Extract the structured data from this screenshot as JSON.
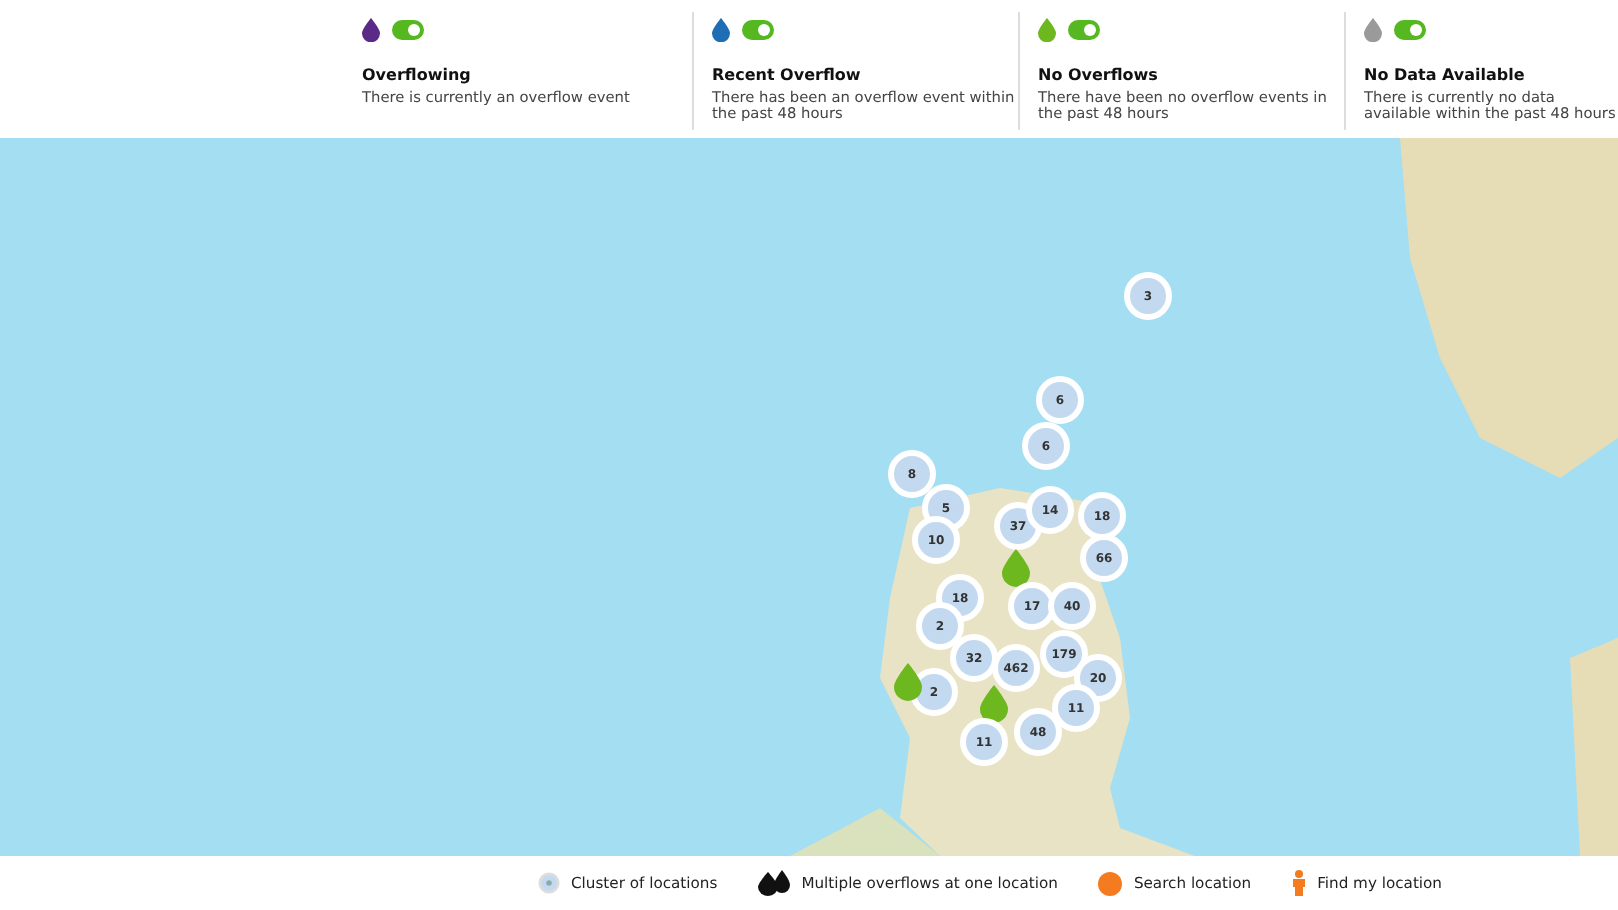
{
  "legend": [
    {
      "title": "Overflowing",
      "description": "There is currently an overflow event",
      "color": "#5b2a86",
      "on": true
    },
    {
      "title": "Recent Overflow",
      "description": "There has been an overflow event within the past 48 hours",
      "color": "#1f6db5",
      "on": true
    },
    {
      "title": "No Overflows",
      "description": "There have been no overflow events in the past 48 hours",
      "color": "#6cb81e",
      "on": true
    },
    {
      "title": "No Data Available",
      "description": "There is currently no data available within the past 48 hours",
      "color": "#9a9a9a",
      "on": true
    }
  ],
  "map": {
    "markers": [
      {
        "kind": "cluster",
        "count": "3"
      },
      {
        "kind": "cluster",
        "count": "6"
      },
      {
        "kind": "cluster",
        "count": "6"
      },
      {
        "kind": "cluster",
        "count": "8"
      },
      {
        "kind": "cluster",
        "count": "5"
      },
      {
        "kind": "cluster",
        "count": "10"
      },
      {
        "kind": "cluster",
        "count": "37"
      },
      {
        "kind": "cluster",
        "count": "14"
      },
      {
        "kind": "cluster",
        "count": "18"
      },
      {
        "kind": "cluster",
        "count": "66"
      },
      {
        "kind": "drop",
        "color": "#6cb81e"
      },
      {
        "kind": "cluster",
        "count": "18"
      },
      {
        "kind": "cluster",
        "count": "17"
      },
      {
        "kind": "cluster",
        "count": "40"
      },
      {
        "kind": "cluster",
        "count": "2"
      },
      {
        "kind": "cluster",
        "count": "32"
      },
      {
        "kind": "cluster",
        "count": "462"
      },
      {
        "kind": "cluster",
        "count": "179"
      },
      {
        "kind": "cluster",
        "count": "20"
      },
      {
        "kind": "cluster",
        "count": "2"
      },
      {
        "kind": "drop",
        "color": "#6cb81e"
      },
      {
        "kind": "cluster",
        "count": "11"
      },
      {
        "kind": "drop",
        "color": "#6cb81e"
      },
      {
        "kind": "cluster",
        "count": "48"
      },
      {
        "kind": "cluster",
        "count": "11"
      }
    ]
  },
  "key": [
    {
      "kind": "cluster",
      "label": "Cluster of locations"
    },
    {
      "kind": "multi",
      "label": "Multiple overflows at one location"
    },
    {
      "kind": "search",
      "label": "Search location"
    },
    {
      "kind": "person",
      "label": "Find my location"
    }
  ]
}
